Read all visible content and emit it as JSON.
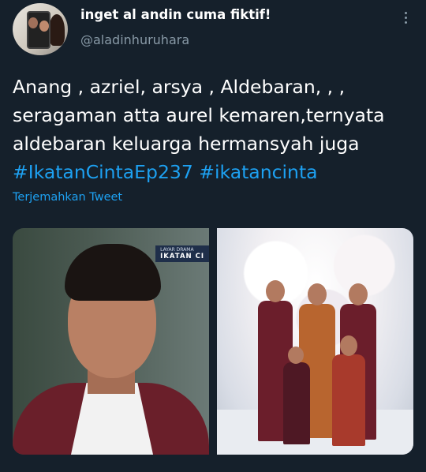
{
  "tweet": {
    "author_name": "inget al andin cuma fiktif!",
    "author_handle": "@aladinhuruhara",
    "text_lines": [
      "Anang , azriel, arsya , Aldebaran, , ,",
      "seragaman atta aurel kemaren,ternyata",
      "aldebaran keluarga hermansyah juga"
    ],
    "hashtags": [
      "#IkatanCintaEp237",
      "#ikatancinta"
    ],
    "translate_label": "Terjemahkan Tweet"
  },
  "media": {
    "image1_badge_top": "LAYAR DRAMA",
    "image1_badge_bottom": "IKATAN CI"
  },
  "icons": {
    "more": "more-vertical-icon"
  },
  "colors": {
    "background": "#15202b",
    "accent": "#1da1f2",
    "secondary_text": "#8899a6"
  }
}
